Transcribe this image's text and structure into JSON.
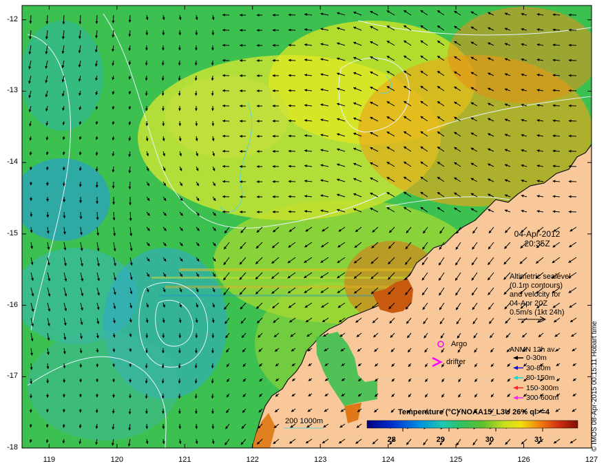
{
  "map": {
    "lat_ticks": [
      "-12",
      "-13",
      "-14",
      "-15",
      "-16",
      "-17",
      "-18"
    ],
    "lon_ticks": [
      "119",
      "120",
      "121",
      "122",
      "123",
      "124",
      "125",
      "126",
      "127"
    ],
    "lat_range": [
      -18,
      -11.8
    ],
    "lon_range": [
      118.6,
      127
    ],
    "colors": {
      "land": "#f8c89a",
      "coast": "#111111",
      "contour": "#e8f4ff",
      "isobath": "#5ad0e0"
    }
  },
  "annotations": {
    "date": "04-Apr-2012",
    "time": "20:35Z",
    "altimetry_lines": [
      "Altimetric sealevel",
      "(0.1m contours)",
      "and velocity for",
      "04-Apr 20Z",
      "0.5m/s (1kt 24h)"
    ],
    "argo_label": "Argo",
    "drifter_label": "drifter",
    "isobath_label": "200  1000m",
    "credit": "© IMOS 08-Apr-2015 00:15:11 Hobart time"
  },
  "legend": {
    "title": "ANMN 12h av.",
    "items": [
      {
        "label": "0-30m",
        "color": "#000000"
      },
      {
        "label": "30-80m",
        "color": "#1010e0"
      },
      {
        "label": "80-150m",
        "color": "#00e0e0"
      },
      {
        "label": "150-300m",
        "color": "#ff2020"
      },
      {
        "label": "300-600m",
        "color": "#ff20ff"
      }
    ]
  },
  "colorbar": {
    "title": "Temperature (°C) NOAA15_L3U 26% ql>=4",
    "ticks": [
      "28",
      "29",
      "30",
      "31"
    ],
    "range": [
      27.5,
      31.8
    ]
  }
}
